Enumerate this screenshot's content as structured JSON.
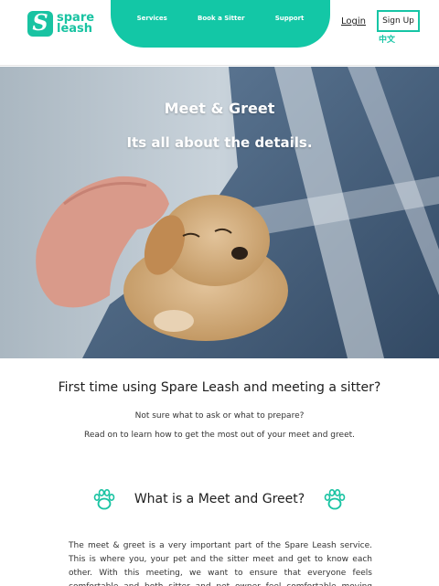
{
  "brand": {
    "line1": "spare",
    "line2": "leash",
    "mark": "S",
    "color": "#19c3a2"
  },
  "nav": {
    "items": [
      "Services",
      "Book a Sitter",
      "Support"
    ],
    "login": "Login",
    "signup": "Sign Up",
    "language": "中文"
  },
  "hero": {
    "title": "Meet & Greet",
    "subtitle": "Its all about the details."
  },
  "intro": {
    "heading": "First time using Spare Leash and meeting a sitter?",
    "line1": "Not sure what to ask or what to prepare?",
    "line2": "Read on to learn how to get the most out of your meet and greet."
  },
  "section": {
    "title": "What is a Meet and Greet?",
    "icon": "paw-icon",
    "body": "The meet & greet is a very important part of the Spare Leash service. This is where you, your pet and the sitter meet and get to know each other. With this meeting, we want to ensure that everyone feels comfortable and both sitter and pet owner feel comfortable moving forward with the"
  }
}
